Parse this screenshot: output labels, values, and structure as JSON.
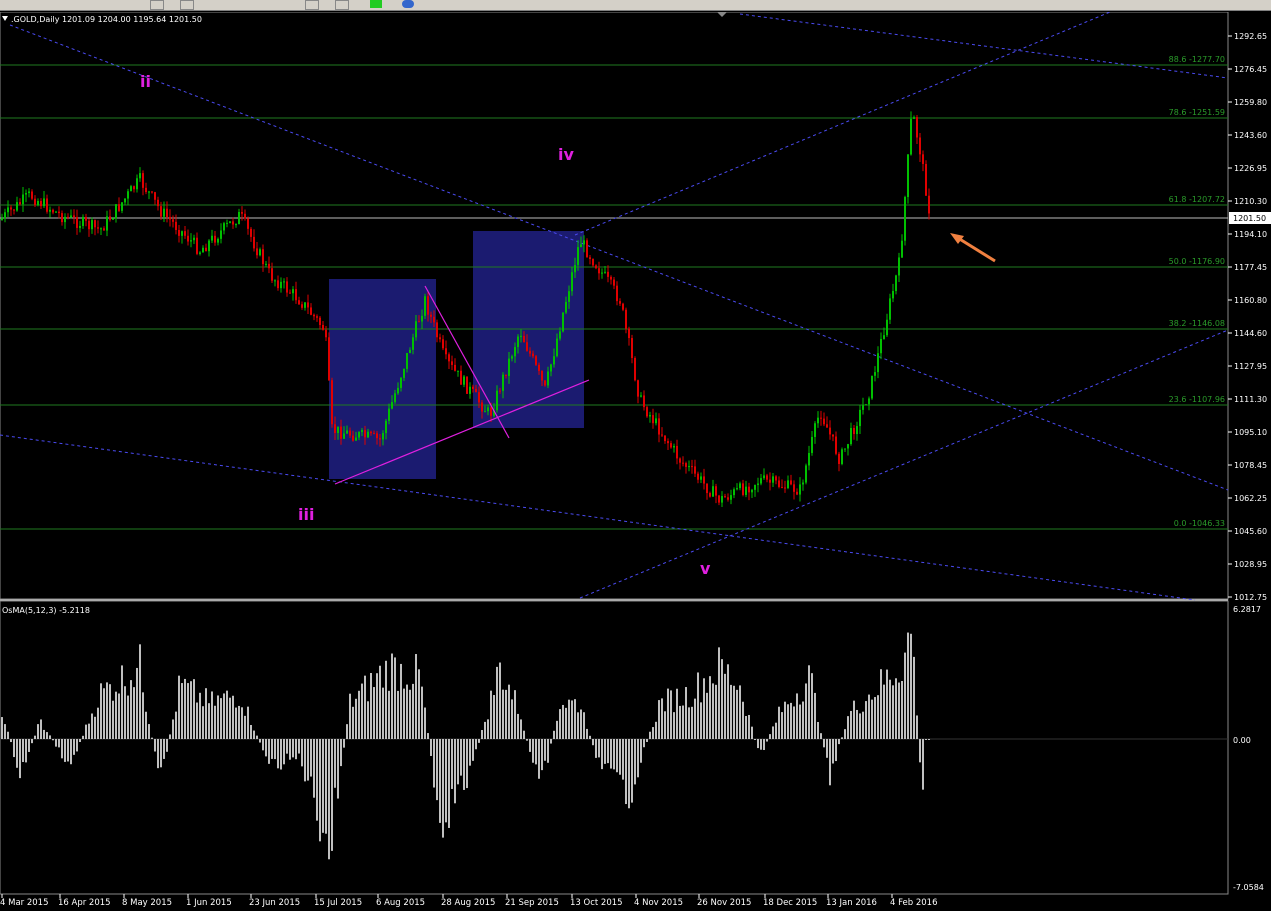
{
  "symbol_header": ".GOLD,Daily  1201.09 1204.00 1195.64 1201.50",
  "current_price": "1201.50",
  "price_axis": [
    "1292.65",
    "1276.45",
    "1259.80",
    "1243.60",
    "1226.95",
    "1210.30",
    "1194.10",
    "1177.45",
    "1160.80",
    "1144.60",
    "1127.95",
    "1111.30",
    "1095.10",
    "1078.45",
    "1062.25",
    "1045.60",
    "1028.95",
    "1012.75"
  ],
  "fib_levels": [
    {
      "label": "88.6 -1277.70"
    },
    {
      "label": "78.6 -1251.59"
    },
    {
      "label": "61.8 -1207.72"
    },
    {
      "label": "50.0 -1176.90"
    },
    {
      "label": "38.2 -1146.08"
    },
    {
      "label": "23.6 -1107.96"
    },
    {
      "label": "0.0 -1046.33"
    }
  ],
  "wave_labels": {
    "ii": "ii",
    "iii": "iii",
    "iv": "iv",
    "v": "v"
  },
  "indicator": {
    "name": "OsMA(5,12,3) -5.2118",
    "max": "6.2817",
    "zero": "0.00",
    "min": "-7.0584"
  },
  "date_axis": [
    "4 Mar 2015",
    "16 Apr 2015",
    "8 May 2015",
    "1 Jun 2015",
    "23 Jun 2015",
    "15 Jul 2015",
    "6 Aug 2015",
    "28 Aug 2015",
    "21 Sep 2015",
    "13 Oct 2015",
    "4 Nov 2015",
    "26 Nov 2015",
    "18 Dec 2015",
    "13 Jan 2016",
    "4 Feb 2016"
  ],
  "colors": {
    "bull": "#00c000",
    "bear": "#e00000",
    "fib": "#1f7a1f",
    "trend": "#4a4af0",
    "box": "#1b1b70",
    "wave": "#e020e0",
    "arrow": "#f08040"
  }
}
